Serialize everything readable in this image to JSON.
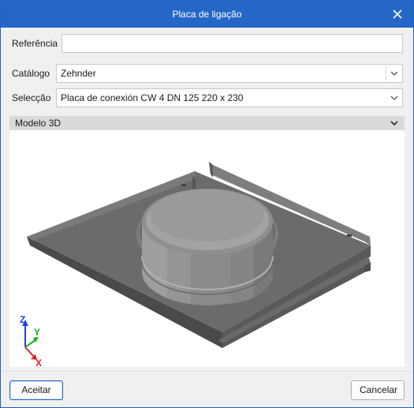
{
  "window": {
    "title": "Placa de ligação",
    "close_icon": "close-icon"
  },
  "form": {
    "reference_label": "Referência",
    "reference_value": "",
    "catalog_label": "Catálogo",
    "catalog_value": "Zehnder",
    "selection_label": "Selecção",
    "selection_value": "Placa de conexión CW 4 DN 125 220 x 230"
  },
  "section": {
    "title": "Modelo 3D",
    "collapse_icon": "chevron-down-icon"
  },
  "viewport": {
    "axes": {
      "x": "X",
      "y": "Y",
      "z": "Z"
    },
    "axis_colors": {
      "x": "#e02020",
      "y": "#20b020",
      "z": "#2040e0"
    },
    "model_color": "#6e6e6e"
  },
  "footer": {
    "accept_label": "Aceitar",
    "cancel_label": "Cancelar"
  },
  "colors": {
    "titlebar": "#2467c7",
    "accent": "#2467c7"
  }
}
